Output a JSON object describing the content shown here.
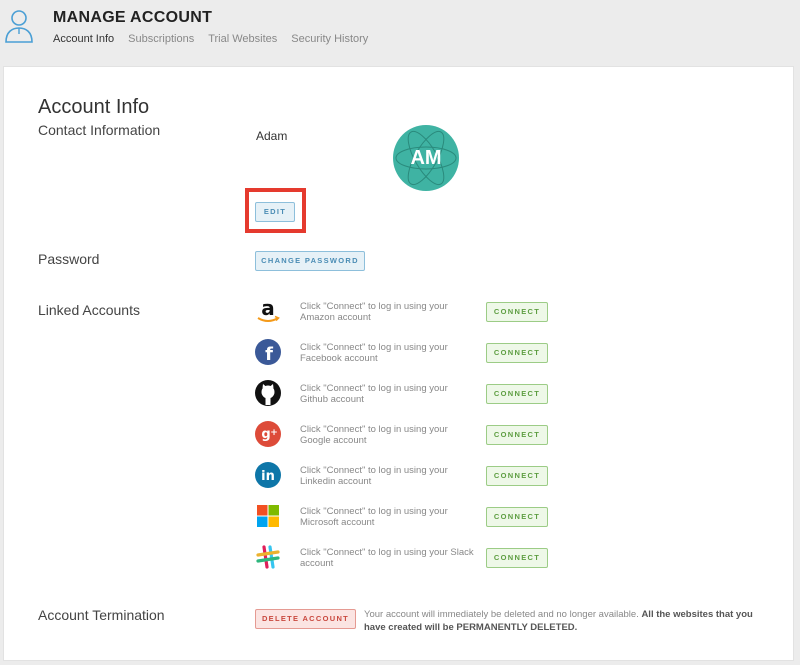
{
  "header": {
    "title": "MANAGE ACCOUNT",
    "tabs": [
      {
        "label": "Account Info",
        "active": true
      },
      {
        "label": "Subscriptions",
        "active": false
      },
      {
        "label": "Trial Websites",
        "active": false
      },
      {
        "label": "Security History",
        "active": false
      }
    ]
  },
  "main": {
    "heading": "Account Info",
    "contact": {
      "label": "Contact Information",
      "name": "Adam",
      "avatar_initials": "AM",
      "avatar_color": "#3fb3a3",
      "edit_label": "EDIT"
    },
    "password": {
      "label": "Password",
      "change_label": "CHANGE PASSWORD"
    },
    "linked": {
      "label": "Linked Accounts",
      "accounts": [
        {
          "service": "Amazon",
          "icon": "amazon-icon",
          "text": "Click \"Connect\" to log in using your Amazon account",
          "button": "CONNECT"
        },
        {
          "service": "Facebook",
          "icon": "facebook-icon",
          "text": "Click \"Connect\" to log in using your Facebook account",
          "button": "CONNECT"
        },
        {
          "service": "Github",
          "icon": "github-icon",
          "text": "Click \"Connect\" to log in using your Github account",
          "button": "CONNECT"
        },
        {
          "service": "Google",
          "icon": "google-plus-icon",
          "text": "Click \"Connect\" to log in using your Google account",
          "button": "CONNECT"
        },
        {
          "service": "Linkedin",
          "icon": "linkedin-icon",
          "text": "Click \"Connect\" to log in using your Linkedin account",
          "button": "CONNECT"
        },
        {
          "service": "Microsoft",
          "icon": "microsoft-icon",
          "text": "Click \"Connect\" to log in using your Microsoft account",
          "button": "CONNECT"
        },
        {
          "service": "Slack",
          "icon": "slack-icon",
          "text": "Click \"Connect\" to log in using your Slack account",
          "button": "CONNECT"
        }
      ]
    },
    "termination": {
      "label": "Account Termination",
      "delete_label": "DELETE ACCOUNT",
      "text_regular": "Your account will immediately be deleted and no longer available. ",
      "text_bold": "All the websites that you have created will be PERMANENTLY DELETED."
    }
  },
  "colors": {
    "highlight": "#e53a2e",
    "connect_green": "#5e9e42",
    "edit_blue": "#4b8db5",
    "delete_red": "#c9483e"
  }
}
